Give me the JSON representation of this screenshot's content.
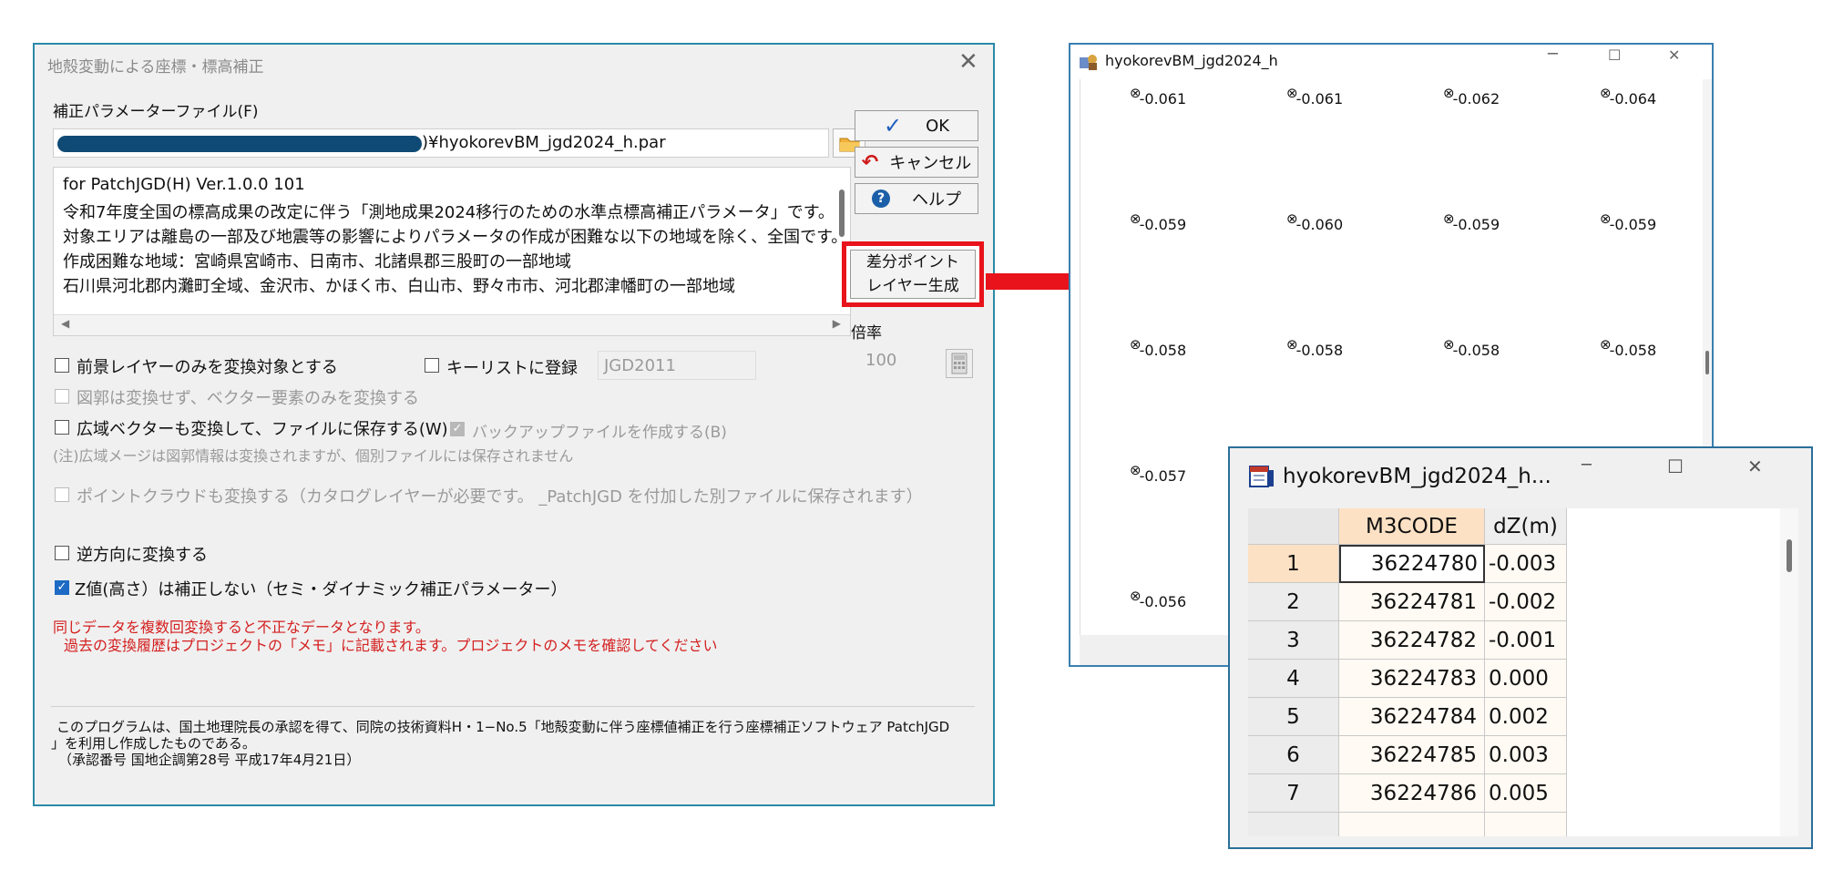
{
  "dialog": {
    "title": "地殻変動による座標・標高補正",
    "close_glyph": "✕",
    "param_file_label": "補正パラメーターファイル(F)",
    "param_file_value": ")¥hyokorevBM_jgd2024_h.par",
    "description_lines": [
      "for PatchJGD(H)      Ver.1.0.0        101",
      "令和7年度全国の標高成果の改定に伴う「測地成果2024移行のための水準点標高補正パラメータ」です。",
      "対象エリアは離島の一部及び地震等の影響によりパラメータの作成が困難な以下の地域を除く、全国です。",
      "    作成困難な地域：宮崎県宮崎市、日南市、北諸県郡三股町の一部地域",
      "    石川県河北郡内灘町全域、金沢市、かほく市、白山市、野々市市、河北郡津幡町の一部地域"
    ],
    "buttons": {
      "ok": "OK",
      "cancel": "キャンセル",
      "help": "ヘルプ",
      "diff_point_line1": "差分ポイント",
      "diff_point_line2": "レイヤー生成"
    },
    "scale_label": "倍率",
    "scale_value": "100",
    "options": {
      "foreground_only": "前景レイヤーのみを変換対象とする",
      "key_list": "キーリストに登録",
      "key_list_value": "JGD2011",
      "vector_only": "図郭は変換せず、ベクター要素のみを変換する",
      "wide_vector": "広域ベクターも変換して、ファイルに保存する(W)",
      "backup": "バックアップファイルを作成する(B)",
      "wide_note": "(注)広域メージは図郭情報は変換されますが、個別ファイルには保存されません",
      "point_cloud": "ポイントクラウドも変換する（カタログレイヤーが必要です。  _PatchJGD を付加した別ファイルに保存されます）",
      "reverse": "逆方向に変換する",
      "z_no_correct": "Z値(高さ）は補正しない（セミ・ダイナミック補正パラメーター）"
    },
    "warning_line1": "同じデータを複数回変換すると不正なデータとなります。",
    "warning_line2": "過去の変換履歴はプロジェクトの「メモ」に記載されます。プロジェクトのメモを確認してください",
    "footer_line1": "このプログラムは、国土地理院長の承認を得て、同院の技術資料H・1−No.5「地殻変動に伴う座標値補正を行う座標補正ソフトウェア PatchJGD",
    "footer_line2": "」を利用し作成したものである。",
    "footer_line3": "（承認番号  国地企調第28号  平成17年4月21日）"
  },
  "map_window": {
    "title": "hyokorevBM_jgd2024_h",
    "point_symbol": "⊗",
    "rows": [
      [
        "-0.061",
        "-0.061",
        "-0.062",
        "-0.064"
      ],
      [
        "-0.059",
        "-0.060",
        "-0.059",
        "-0.059"
      ],
      [
        "-0.058",
        "-0.058",
        "-0.058",
        "-0.058"
      ],
      [
        "-0.057"
      ],
      [
        "-0.056"
      ]
    ]
  },
  "table_window": {
    "title": "hyokorevBM_jgd2024_h...",
    "columns": [
      "M3CODE",
      "dZ(m)"
    ],
    "rows": [
      {
        "num": "1",
        "code": "36224780",
        "dz": "-0.003"
      },
      {
        "num": "2",
        "code": "36224781",
        "dz": "-0.002"
      },
      {
        "num": "3",
        "code": "36224782",
        "dz": "-0.001"
      },
      {
        "num": "4",
        "code": "36224783",
        "dz": "0.000"
      },
      {
        "num": "5",
        "code": "36224784",
        "dz": "0.002"
      },
      {
        "num": "6",
        "code": "36224785",
        "dz": "0.003"
      },
      {
        "num": "7",
        "code": "36224786",
        "dz": "0.005"
      }
    ]
  },
  "colors": {
    "highlight_red": "#e8131b",
    "window_border": "#2b8aa8",
    "selected_header": "#fde1c4"
  }
}
